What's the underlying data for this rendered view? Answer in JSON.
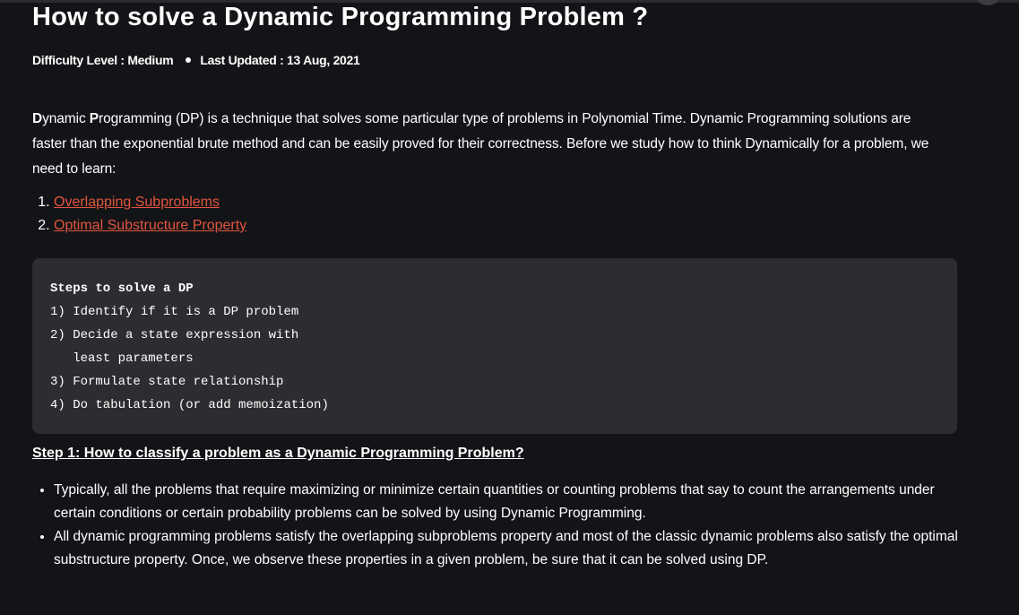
{
  "article": {
    "title": "How to solve a Dynamic Programming Problem ?",
    "difficulty": "Difficulty Level : Medium",
    "last_updated": "Last Updated : 13 Aug, 2021",
    "intro": {
      "bold_1": "D",
      "text_1": "ynamic ",
      "bold_2": "P",
      "text_2": "rogramming (DP) is a technique that solves some particular type of problems in Polynomial Time. Dynamic Programming solutions are faster than the exponential brute method and can be easily proved for their correctness. Before we study how to think Dynamically for a problem, we need to learn:"
    },
    "links": [
      "Overlapping Subproblems",
      "Optimal Substructure Property"
    ],
    "code_lines": [
      "Steps to solve a DP",
      "1) Identify if it is a DP problem",
      "2) Decide a state expression with",
      "   least parameters",
      "3) Formulate state relationship",
      "4) Do tabulation (or add memoization)"
    ],
    "step1_heading": "Step 1: How to classify a problem as a Dynamic Programming Problem?",
    "bullets": [
      "Typically, all the problems that require maximizing or minimize certain quantities or counting problems that say to count the arrangements under certain conditions or certain probability problems can be solved by using Dynamic Programming.",
      "All dynamic programming problems satisfy the overlapping subproblems property and most of the classic dynamic problems also satisfy the optimal substructure property. Once, we observe these properties in a given problem, be sure that it can be solved using DP."
    ]
  },
  "colors": {
    "background": "#131417",
    "link": "#e2553e",
    "code_bg": "#2c2d30"
  }
}
